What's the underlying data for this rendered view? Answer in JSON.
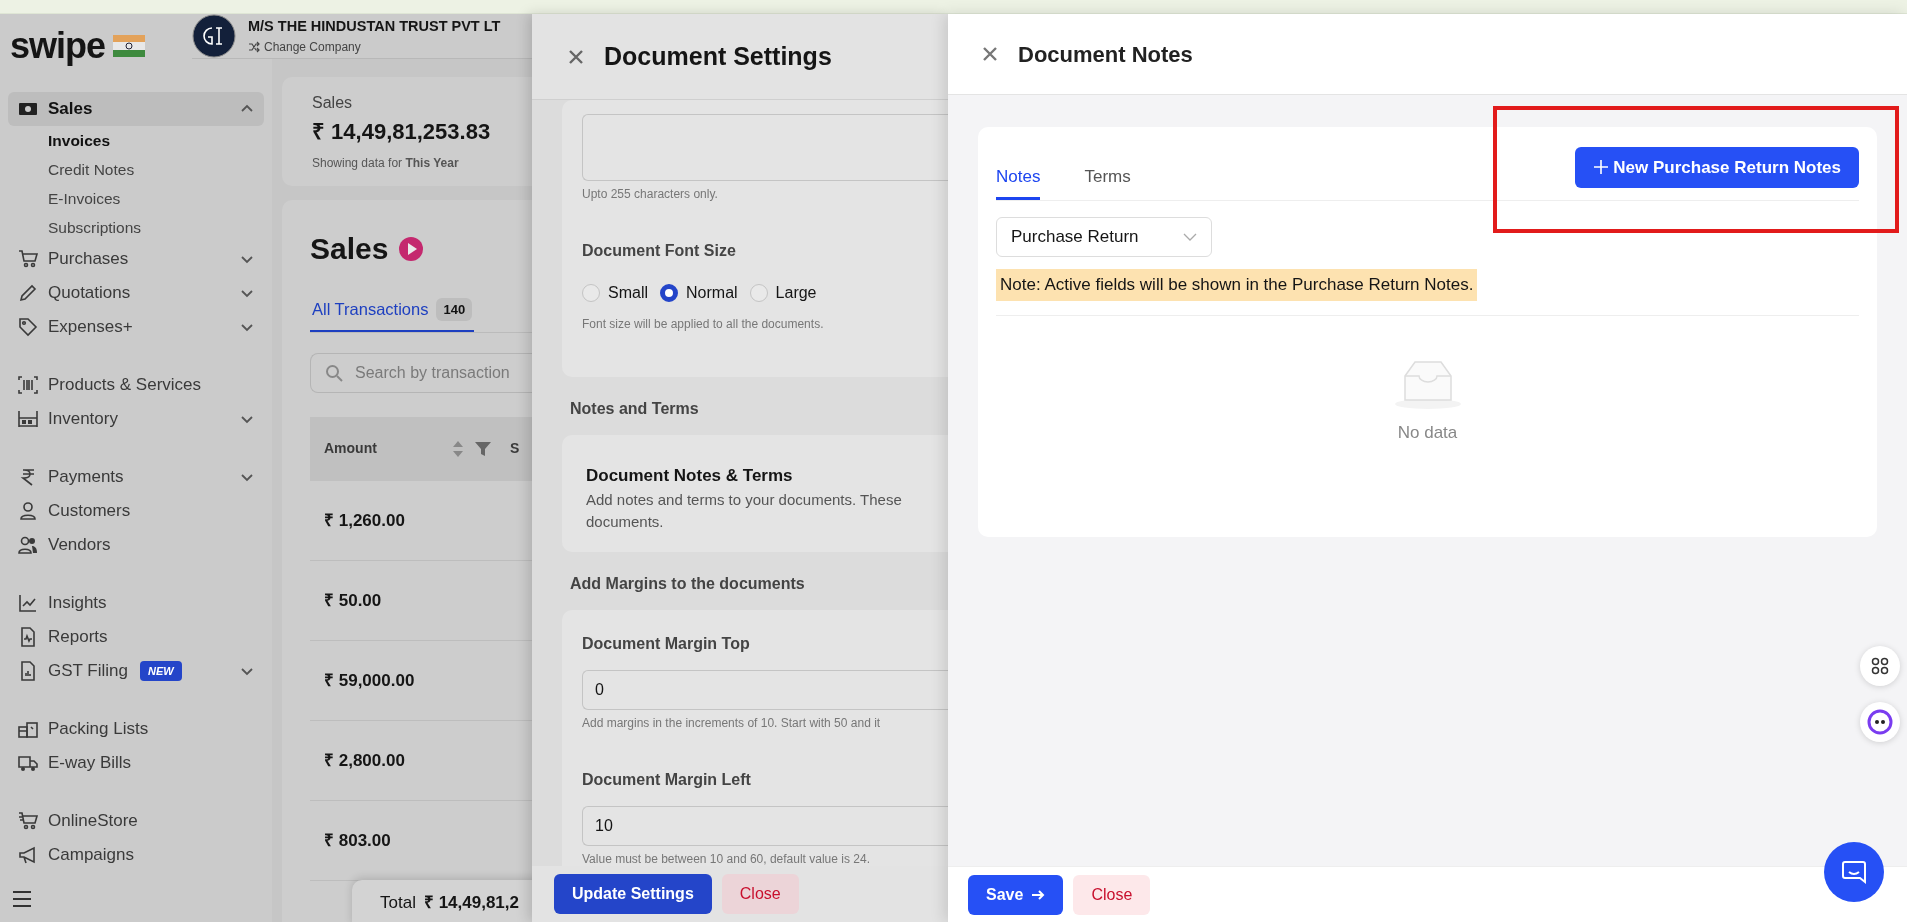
{
  "brand": {
    "logo": "swipe"
  },
  "company": {
    "name": "M/S THE HINDUSTAN TRUST PVT LT",
    "action": "Change Company"
  },
  "sidebar": {
    "groups": [
      {
        "items": [
          {
            "label": "Sales",
            "selected": true,
            "expanded": true,
            "children": [
              {
                "label": "Invoices",
                "selected": true
              },
              {
                "label": "Credit Notes",
                "selected": false
              },
              {
                "label": "E-Invoices",
                "selected": false
              },
              {
                "label": "Subscriptions",
                "selected": false
              }
            ]
          },
          {
            "label": "Purchases",
            "selected": false,
            "expanded": false
          },
          {
            "label": "Quotations",
            "selected": false,
            "expanded": false
          },
          {
            "label": "Expenses+",
            "selected": false,
            "expanded": false
          }
        ]
      },
      {
        "items": [
          {
            "label": "Products & Services",
            "selected": false
          },
          {
            "label": "Inventory",
            "selected": false,
            "expanded": false
          }
        ]
      },
      {
        "items": [
          {
            "label": "Payments",
            "selected": false,
            "expanded": false
          },
          {
            "label": "Customers",
            "selected": false
          },
          {
            "label": "Vendors",
            "selected": false
          }
        ]
      },
      {
        "items": [
          {
            "label": "Insights",
            "selected": false
          },
          {
            "label": "Reports",
            "selected": false
          },
          {
            "label": "GST Filing",
            "selected": false,
            "expanded": false,
            "badge": "NEW"
          }
        ]
      },
      {
        "items": [
          {
            "label": "Packing Lists",
            "selected": false
          },
          {
            "label": "E-way Bills",
            "selected": false
          }
        ]
      },
      {
        "items": [
          {
            "label": "OnlineStore",
            "selected": false
          },
          {
            "label": "Campaigns",
            "selected": false
          }
        ]
      }
    ]
  },
  "summary": {
    "label": "Sales",
    "amount": "₹ 14,49,81,253.83",
    "period": "Showing data for **This Year**"
  },
  "sales": {
    "title": "Sales",
    "tabs": [
      {
        "label": "All Transactions",
        "count": "140",
        "selected": true
      }
    ],
    "search": {
      "placeholder": "Search by transaction"
    },
    "table": {
      "columns": [
        {
          "label": "Amount"
        },
        {
          "label": "S"
        }
      ],
      "rows": [
        {
          "amount": "₹ 1,260.00"
        },
        {
          "amount": "₹ 50.00"
        },
        {
          "amount": "₹ 59,000.00"
        },
        {
          "amount": "₹ 2,800.00"
        },
        {
          "amount": "₹ 803.00"
        }
      ]
    },
    "total": {
      "label": "Total",
      "amount": "₹ 14,49,81,2"
    }
  },
  "settings_drawer": {
    "title": "Document Settings",
    "textarea_hint": "Upto 255 characters only.",
    "font_size": {
      "title": "Document Font Size",
      "options": [
        {
          "label": "Small",
          "selected": false
        },
        {
          "label": "Normal",
          "selected": true
        },
        {
          "label": "Large",
          "selected": false
        }
      ],
      "hint": "Font size will be applied to all the documents."
    },
    "notes_section": {
      "heading": "Notes and Terms",
      "card_title": "Document Notes & Terms",
      "card_text": "Add notes and terms to your documents. These documents."
    },
    "margins_section": {
      "heading": "Add Margins to the documents",
      "fields": [
        {
          "label": "Document Margin Top",
          "value": "0",
          "hint": "Add margins in the increments of 10. Start with 50 and it"
        },
        {
          "label": "Document Margin Left",
          "value": "10",
          "hint": "Value must be between 10 and 60, default value is 24."
        }
      ]
    },
    "buttons": [
      {
        "label": "Update Settings",
        "kind": "primary"
      },
      {
        "label": "Close",
        "kind": "danger"
      }
    ]
  },
  "notes_drawer": {
    "title": "Document Notes",
    "tabs": [
      {
        "label": "Notes",
        "selected": true
      },
      {
        "label": "Terms",
        "selected": false
      }
    ],
    "new_button": "New Purchase Return Notes",
    "select": {
      "value": "Purchase Return"
    },
    "note": "Note: Active fields will be shown in the Purchase Return Notes.",
    "empty": "No data",
    "buttons": [
      {
        "label": "Save",
        "kind": "primary"
      },
      {
        "label": "Close",
        "kind": "danger"
      }
    ]
  }
}
